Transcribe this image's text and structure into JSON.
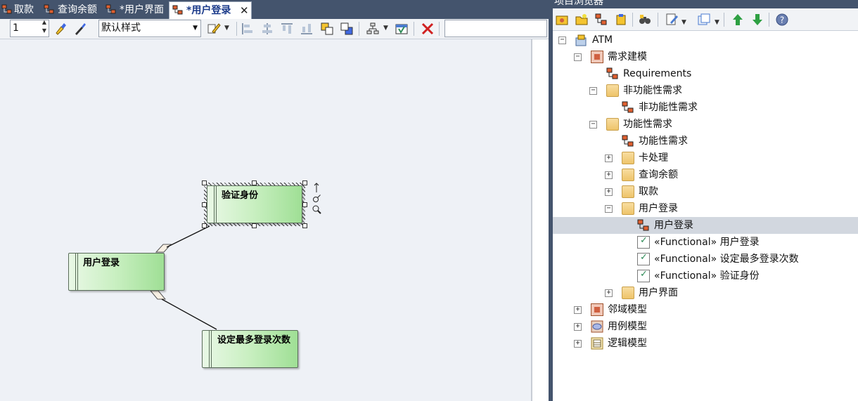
{
  "tabs": [
    {
      "label": "取款"
    },
    {
      "label": "查询余额"
    },
    {
      "label": "*用户界面"
    },
    {
      "label": "*用户登录",
      "active": true
    }
  ],
  "toolbar": {
    "spin_value": "1",
    "style_select": "默认样式"
  },
  "diagram": {
    "nodes": [
      {
        "label": "验证身份",
        "selected": true
      },
      {
        "label": "用户登录"
      },
      {
        "label": "设定最多登录次数"
      }
    ]
  },
  "browser": {
    "title": "项目浏览器",
    "tree": [
      {
        "label": "ATM",
        "icon": "model-root-icon",
        "expander": "minus"
      },
      {
        "label": "需求建模",
        "icon": "package-icon",
        "expander": "minus"
      },
      {
        "label": "Requirements",
        "icon": "diagram-icon",
        "expander": ""
      },
      {
        "label": "非功能性需求",
        "icon": "folder-icon",
        "expander": "minus"
      },
      {
        "label": "非功能性需求",
        "icon": "diagram-icon",
        "expander": ""
      },
      {
        "label": "功能性需求",
        "icon": "folder-icon",
        "expander": "minus"
      },
      {
        "label": "功能性需求",
        "icon": "diagram-icon",
        "expander": ""
      },
      {
        "label": "卡处理",
        "icon": "folder-icon",
        "expander": "plus"
      },
      {
        "label": "查询余额",
        "icon": "folder-icon",
        "expander": "plus"
      },
      {
        "label": "取款",
        "icon": "folder-icon",
        "expander": "plus"
      },
      {
        "label": "用户登录",
        "icon": "folder-icon",
        "expander": "minus"
      },
      {
        "label": "用户登录",
        "icon": "diagram-icon",
        "expander": "",
        "selected": true
      },
      {
        "label": "«Functional» 用户登录",
        "icon": "requirement-icon",
        "expander": ""
      },
      {
        "label": "«Functional» 设定最多登录次数",
        "icon": "requirement-icon",
        "expander": ""
      },
      {
        "label": "«Functional» 验证身份",
        "icon": "requirement-icon",
        "expander": ""
      },
      {
        "label": "用户界面",
        "icon": "folder-icon",
        "expander": "plus"
      },
      {
        "label": "邻域模型",
        "icon": "package-icon",
        "expander": "plus"
      },
      {
        "label": "用例模型",
        "icon": "usecase-package-icon",
        "expander": "plus"
      },
      {
        "label": "逻辑模型",
        "icon": "logical-package-icon",
        "expander": "plus"
      }
    ]
  },
  "colors": {
    "chrome": "#44546d",
    "node_green": "#9fdf95",
    "selection": "#d2d7df"
  }
}
